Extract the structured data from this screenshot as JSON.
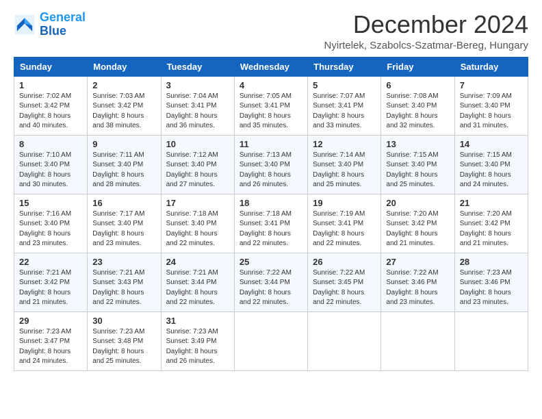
{
  "header": {
    "logo_line1": "General",
    "logo_line2": "Blue",
    "month_year": "December 2024",
    "location": "Nyirtelek, Szabolcs-Szatmar-Bereg, Hungary"
  },
  "days_of_week": [
    "Sunday",
    "Monday",
    "Tuesday",
    "Wednesday",
    "Thursday",
    "Friday",
    "Saturday"
  ],
  "weeks": [
    [
      {
        "day": 1,
        "sunrise": "7:02 AM",
        "sunset": "3:42 PM",
        "daylight": "8 hours and 40 minutes."
      },
      {
        "day": 2,
        "sunrise": "7:03 AM",
        "sunset": "3:42 PM",
        "daylight": "8 hours and 38 minutes."
      },
      {
        "day": 3,
        "sunrise": "7:04 AM",
        "sunset": "3:41 PM",
        "daylight": "8 hours and 36 minutes."
      },
      {
        "day": 4,
        "sunrise": "7:05 AM",
        "sunset": "3:41 PM",
        "daylight": "8 hours and 35 minutes."
      },
      {
        "day": 5,
        "sunrise": "7:07 AM",
        "sunset": "3:41 PM",
        "daylight": "8 hours and 33 minutes."
      },
      {
        "day": 6,
        "sunrise": "7:08 AM",
        "sunset": "3:40 PM",
        "daylight": "8 hours and 32 minutes."
      },
      {
        "day": 7,
        "sunrise": "7:09 AM",
        "sunset": "3:40 PM",
        "daylight": "8 hours and 31 minutes."
      }
    ],
    [
      {
        "day": 8,
        "sunrise": "7:10 AM",
        "sunset": "3:40 PM",
        "daylight": "8 hours and 30 minutes."
      },
      {
        "day": 9,
        "sunrise": "7:11 AM",
        "sunset": "3:40 PM",
        "daylight": "8 hours and 28 minutes."
      },
      {
        "day": 10,
        "sunrise": "7:12 AM",
        "sunset": "3:40 PM",
        "daylight": "8 hours and 27 minutes."
      },
      {
        "day": 11,
        "sunrise": "7:13 AM",
        "sunset": "3:40 PM",
        "daylight": "8 hours and 26 minutes."
      },
      {
        "day": 12,
        "sunrise": "7:14 AM",
        "sunset": "3:40 PM",
        "daylight": "8 hours and 25 minutes."
      },
      {
        "day": 13,
        "sunrise": "7:15 AM",
        "sunset": "3:40 PM",
        "daylight": "8 hours and 25 minutes."
      },
      {
        "day": 14,
        "sunrise": "7:15 AM",
        "sunset": "3:40 PM",
        "daylight": "8 hours and 24 minutes."
      }
    ],
    [
      {
        "day": 15,
        "sunrise": "7:16 AM",
        "sunset": "3:40 PM",
        "daylight": "8 hours and 23 minutes."
      },
      {
        "day": 16,
        "sunrise": "7:17 AM",
        "sunset": "3:40 PM",
        "daylight": "8 hours and 23 minutes."
      },
      {
        "day": 17,
        "sunrise": "7:18 AM",
        "sunset": "3:40 PM",
        "daylight": "8 hours and 22 minutes."
      },
      {
        "day": 18,
        "sunrise": "7:18 AM",
        "sunset": "3:41 PM",
        "daylight": "8 hours and 22 minutes."
      },
      {
        "day": 19,
        "sunrise": "7:19 AM",
        "sunset": "3:41 PM",
        "daylight": "8 hours and 22 minutes."
      },
      {
        "day": 20,
        "sunrise": "7:20 AM",
        "sunset": "3:42 PM",
        "daylight": "8 hours and 21 minutes."
      },
      {
        "day": 21,
        "sunrise": "7:20 AM",
        "sunset": "3:42 PM",
        "daylight": "8 hours and 21 minutes."
      }
    ],
    [
      {
        "day": 22,
        "sunrise": "7:21 AM",
        "sunset": "3:42 PM",
        "daylight": "8 hours and 21 minutes."
      },
      {
        "day": 23,
        "sunrise": "7:21 AM",
        "sunset": "3:43 PM",
        "daylight": "8 hours and 22 minutes."
      },
      {
        "day": 24,
        "sunrise": "7:21 AM",
        "sunset": "3:44 PM",
        "daylight": "8 hours and 22 minutes."
      },
      {
        "day": 25,
        "sunrise": "7:22 AM",
        "sunset": "3:44 PM",
        "daylight": "8 hours and 22 minutes."
      },
      {
        "day": 26,
        "sunrise": "7:22 AM",
        "sunset": "3:45 PM",
        "daylight": "8 hours and 22 minutes."
      },
      {
        "day": 27,
        "sunrise": "7:22 AM",
        "sunset": "3:46 PM",
        "daylight": "8 hours and 23 minutes."
      },
      {
        "day": 28,
        "sunrise": "7:23 AM",
        "sunset": "3:46 PM",
        "daylight": "8 hours and 23 minutes."
      }
    ],
    [
      {
        "day": 29,
        "sunrise": "7:23 AM",
        "sunset": "3:47 PM",
        "daylight": "8 hours and 24 minutes."
      },
      {
        "day": 30,
        "sunrise": "7:23 AM",
        "sunset": "3:48 PM",
        "daylight": "8 hours and 25 minutes."
      },
      {
        "day": 31,
        "sunrise": "7:23 AM",
        "sunset": "3:49 PM",
        "daylight": "8 hours and 26 minutes."
      },
      null,
      null,
      null,
      null
    ]
  ]
}
